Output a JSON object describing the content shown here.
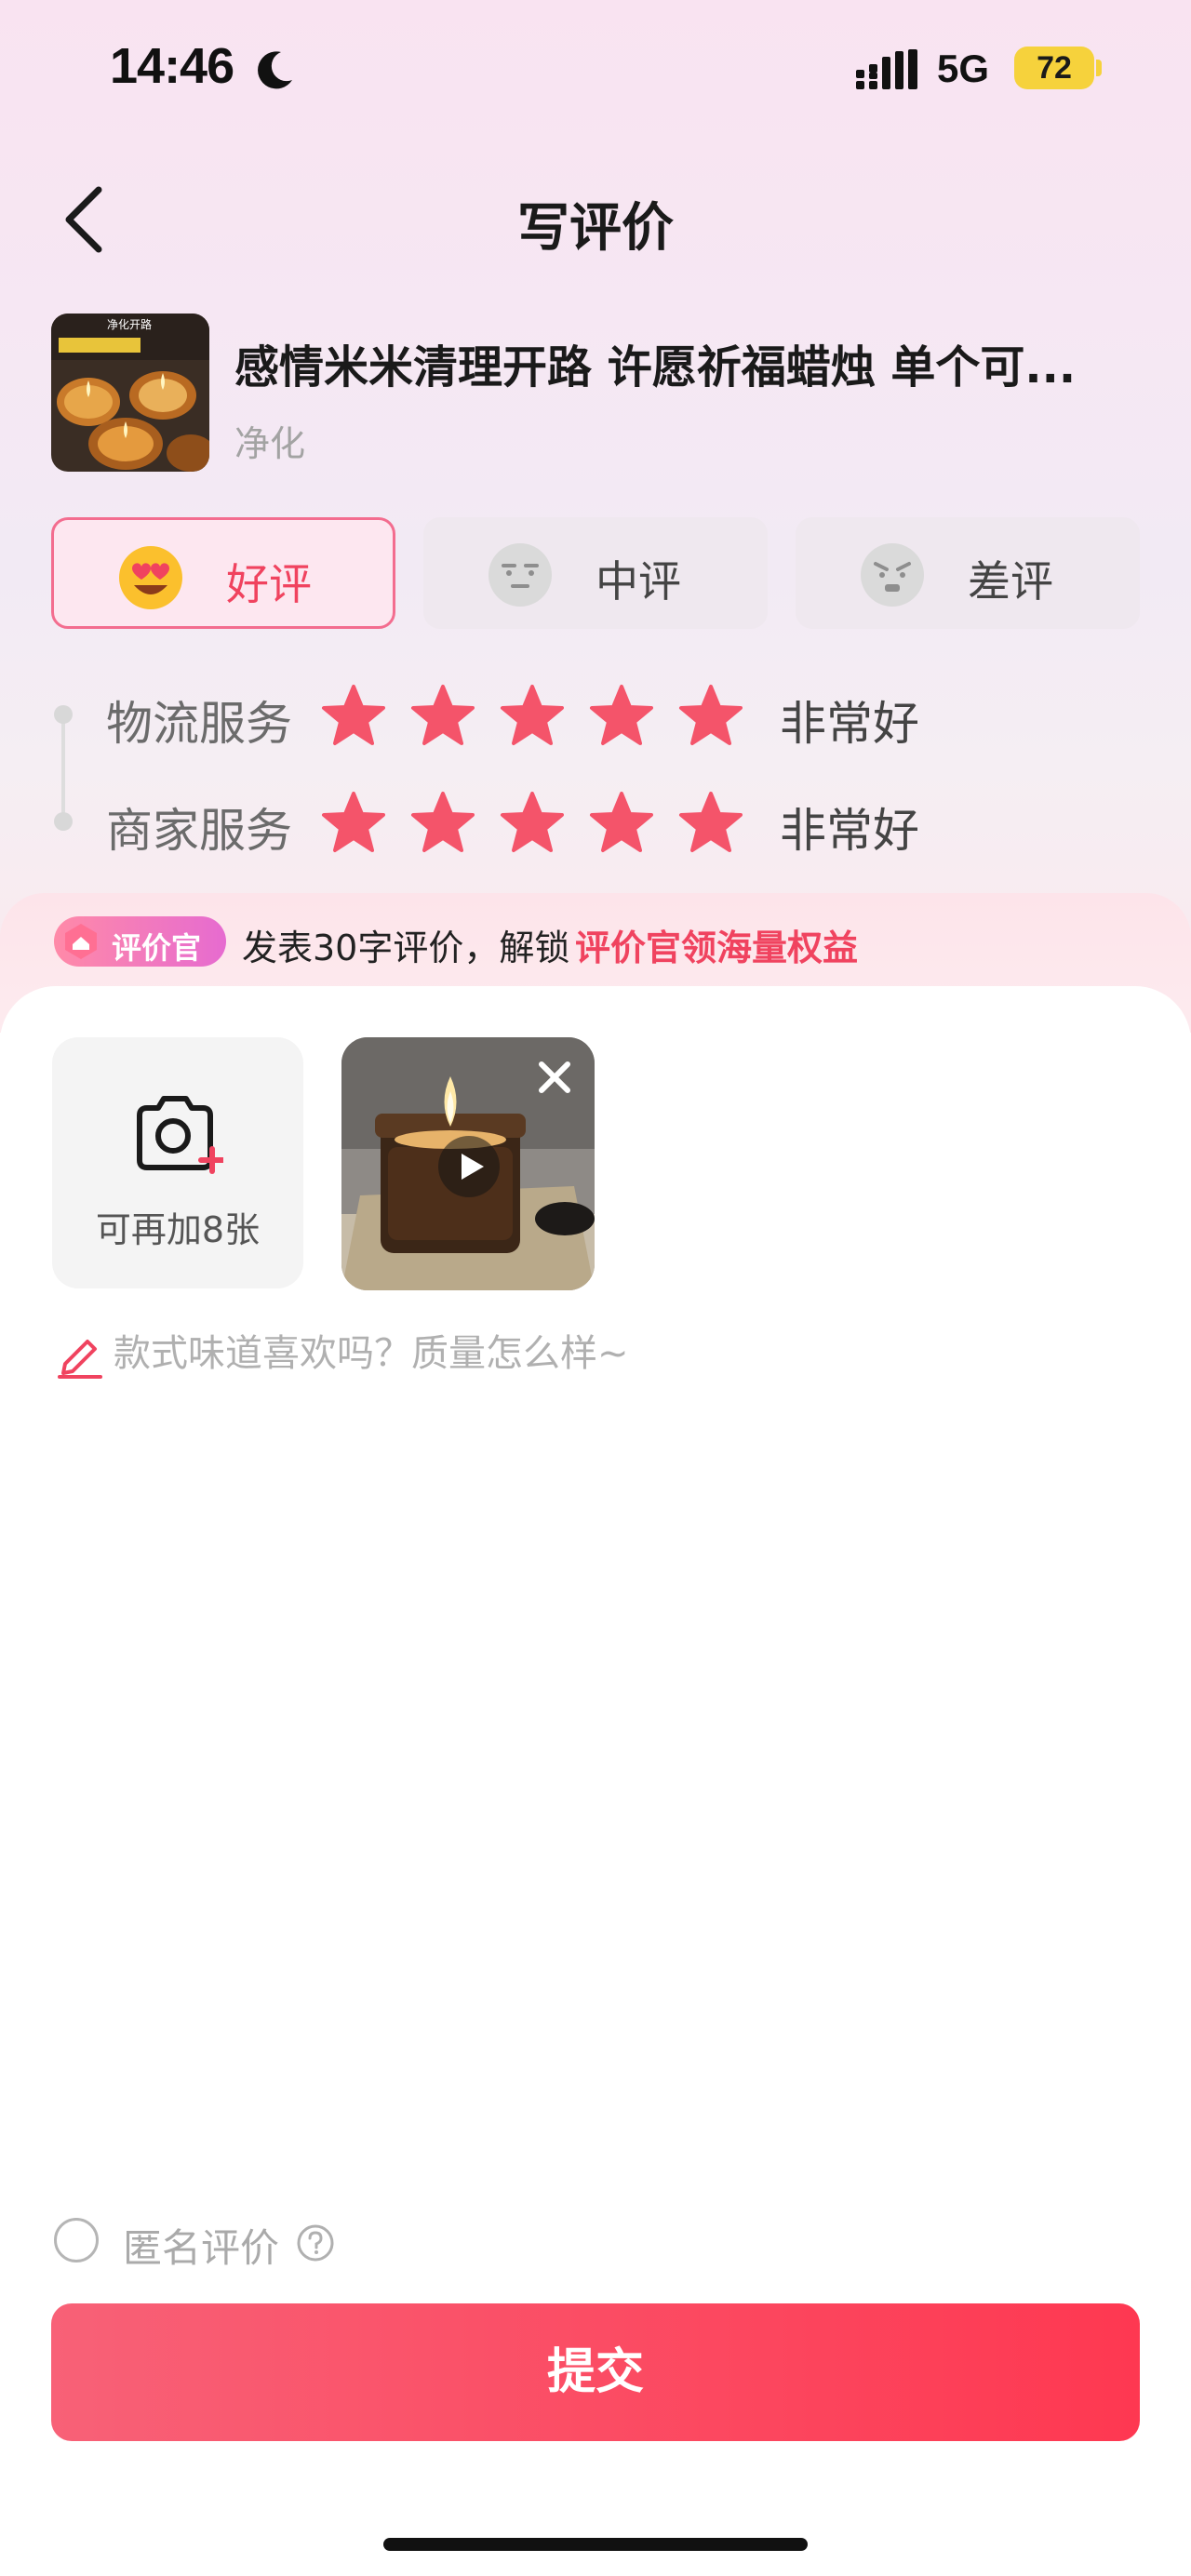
{
  "status_bar": {
    "time": "14:46",
    "network": "5G",
    "battery": "72"
  },
  "header": {
    "title": "写评价"
  },
  "product": {
    "title": "感情米米清理开路 许愿祈福蜡烛 单个可...",
    "spec": "净化",
    "thumb_caption": "净化开路"
  },
  "rating_tabs": [
    {
      "label": "好评",
      "selected": true
    },
    {
      "label": "中评",
      "selected": false
    },
    {
      "label": "差评",
      "selected": false
    }
  ],
  "service_ratings": [
    {
      "label": "物流服务",
      "stars": 5,
      "value": "非常好"
    },
    {
      "label": "商家服务",
      "stars": 5,
      "value": "非常好"
    }
  ],
  "banner": {
    "badge": "评价官",
    "text": "发表30字评价，解锁",
    "link": "评价官领海量权益"
  },
  "media": {
    "add_label": "可再加8张"
  },
  "review": {
    "placeholder": "款式味道喜欢吗？质量怎么样~",
    "value": ""
  },
  "anonymous": {
    "label": "匿名评价",
    "checked": false
  },
  "submit": {
    "label": "提交"
  },
  "colors": {
    "accent": "#f0435f",
    "star": "#f4546a",
    "submit_start": "#f86177",
    "submit_end": "#fe3851",
    "battery": "#f6d23c"
  }
}
